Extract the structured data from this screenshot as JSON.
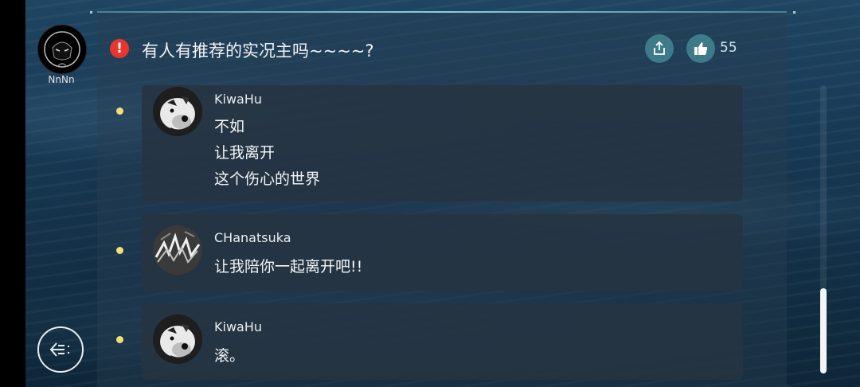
{
  "user": {
    "name": "NnNn"
  },
  "post": {
    "title": "有人有推荐的实况主吗~~~~?",
    "like_count": "55"
  },
  "replies": [
    {
      "author": "KiwaHu",
      "lines": [
        "不如",
        "让我离开",
        "这个伤心的世界"
      ],
      "avatar_icon": "dog-avatar"
    },
    {
      "author": "CHanatsuka",
      "lines": [
        "让我陪你一起离开吧!!"
      ],
      "avatar_icon": "abstract-avatar"
    },
    {
      "author": "KiwaHu",
      "lines": [
        "滚。"
      ],
      "avatar_icon": "dog-avatar"
    }
  ],
  "icons": {
    "warning": "warning-icon",
    "share": "share-icon",
    "like": "thumbs-up-icon",
    "back": "back-arrow-icon"
  },
  "colors": {
    "accent": "#3d7a8a",
    "warning": "#e8352d",
    "bullet": "#f1e07a"
  }
}
